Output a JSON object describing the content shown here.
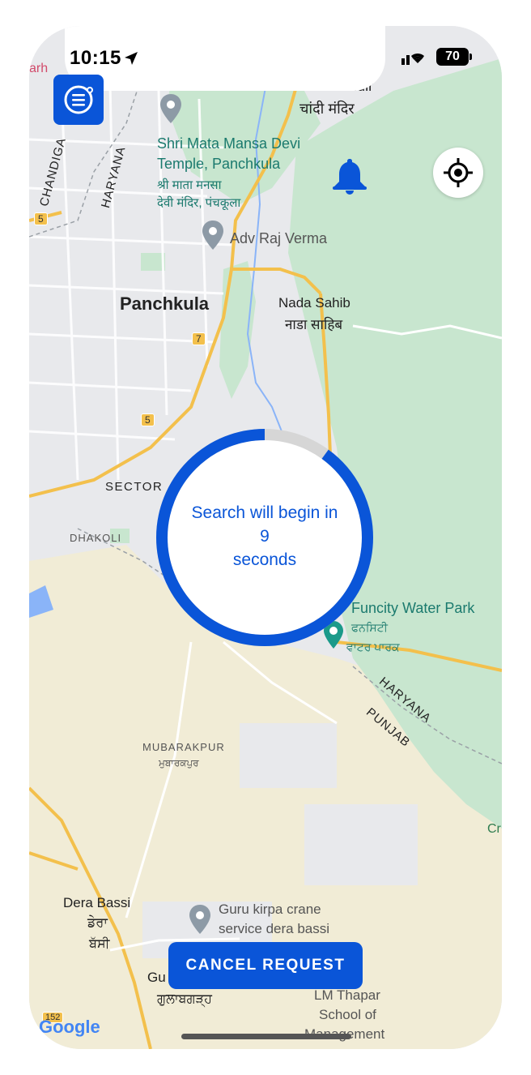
{
  "status_bar": {
    "time": "10:15",
    "battery": "70"
  },
  "map": {
    "labels": {
      "chandi_mandir": "Chandi Mandir",
      "chandi_mandir_hi": "चांदी मंदिर",
      "mansa_devi_1": "Shri Mata Mansa Devi",
      "mansa_devi_2": "Temple, Panchkula",
      "mansa_devi_hi_1": "श्री माता मनसा",
      "mansa_devi_hi_2": "देवी मंदिर, पंचकूला",
      "adv_raj": "Adv Raj Verma",
      "panchkula": "Panchkula",
      "nada_sahib": "Nada Sahib",
      "nada_sahib_hi": "नाडा साहिब",
      "chandigarh": "CHANDIGA",
      "haryana_top": "HARYANA",
      "arh": "arh",
      "sector": "SECTOR",
      "dhakoli": "DHAKOLI",
      "funcity": "Funcity Water Park",
      "funcity_pa_1": "ਫਨਸਿਟੀ",
      "funcity_pa_2": "ਵਾਟਰ ਪਾਰਕ",
      "haryana_bottom": "HARYANA",
      "punjab": "PUNJAB",
      "mubarakpur": "MUBARAKPUR",
      "mubarakpur_pa": "ਮੁਬਾਰਕਪੁਰ",
      "cr": "Cr",
      "dera_bassi": "Dera Bassi",
      "dera_pa": "ਡੇਰਾ",
      "bassi_pa": "ਬੱਸੀ",
      "guru_kirpa_1": "Guru kirpa crane",
      "guru_kirpa_2": "service dera bassi",
      "gu": "Gu",
      "gulabgarh_pa": "ਗੁਲਾਬਗੜ੍ਹ",
      "lm_thapar_1": "LM Thapar",
      "lm_thapar_2": "School of",
      "lm_thapar_3": "Management",
      "google": "Google"
    },
    "road_shields": [
      "5",
      "7",
      "5",
      "152"
    ]
  },
  "countdown": {
    "line1": "Search will begin in",
    "seconds": "9",
    "line3": "seconds",
    "progress_fraction": 0.9
  },
  "cancel_button": {
    "label": "CANCEL REQUEST"
  },
  "colors": {
    "accent": "#0a55d8",
    "map_bg": "#e8e9ec",
    "park_green": "#c8e6cf",
    "road_yellow": "#f3c04c"
  },
  "icons": {
    "menu": "menu-list-icon",
    "locate": "crosshair-icon",
    "bell": "bell-icon"
  }
}
